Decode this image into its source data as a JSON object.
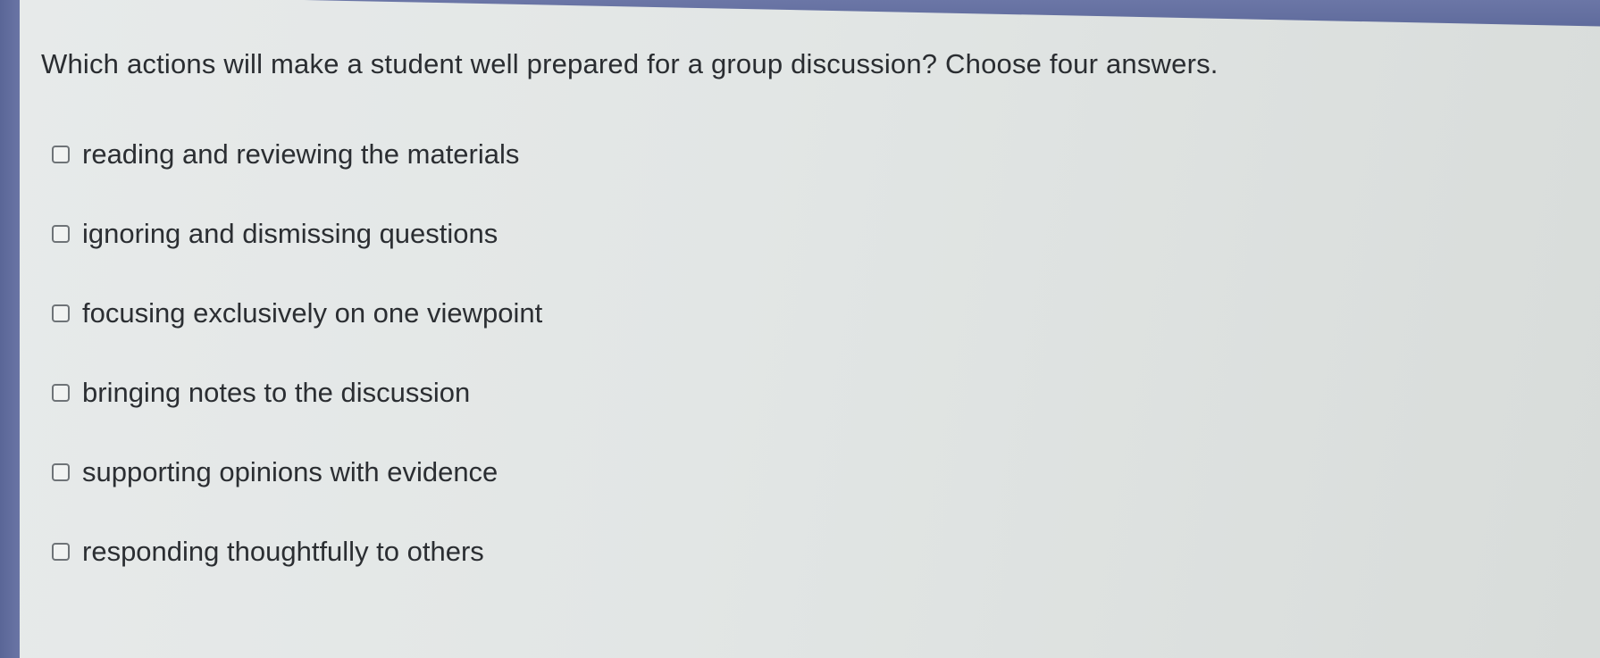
{
  "question": {
    "text": "Which actions will make a student well prepared for a group discussion? Choose four answers."
  },
  "options": [
    {
      "label": "reading and reviewing the materials",
      "checked": false
    },
    {
      "label": "ignoring and dismissing questions",
      "checked": false
    },
    {
      "label": "focusing exclusively on one viewpoint",
      "checked": false
    },
    {
      "label": "bringing notes to the discussion",
      "checked": false
    },
    {
      "label": "supporting opinions with evidence",
      "checked": false
    },
    {
      "label": "responding thoughtfully to others",
      "checked": false
    }
  ],
  "colors": {
    "frame": "#5d6a9a",
    "panel": "#e3e6e5",
    "text": "#2a2d31"
  }
}
